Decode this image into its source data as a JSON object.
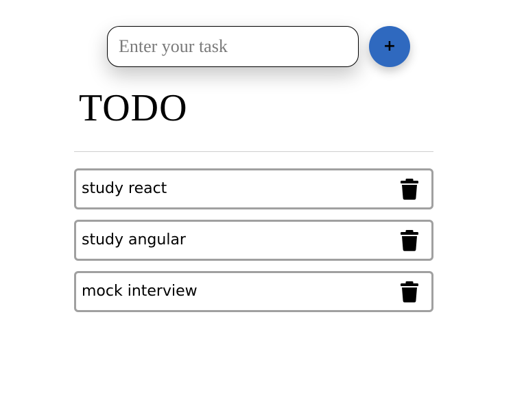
{
  "task_input": {
    "placeholder": "Enter your task",
    "value": ""
  },
  "add_button": {
    "label": "+",
    "color": "#2f69bf"
  },
  "page_title": "TODO",
  "tasks": [
    {
      "text": "study react",
      "delete_icon": "trash-icon"
    },
    {
      "text": "study angular",
      "delete_icon": "trash-icon"
    },
    {
      "text": "mock interview",
      "delete_icon": "trash-icon"
    }
  ]
}
